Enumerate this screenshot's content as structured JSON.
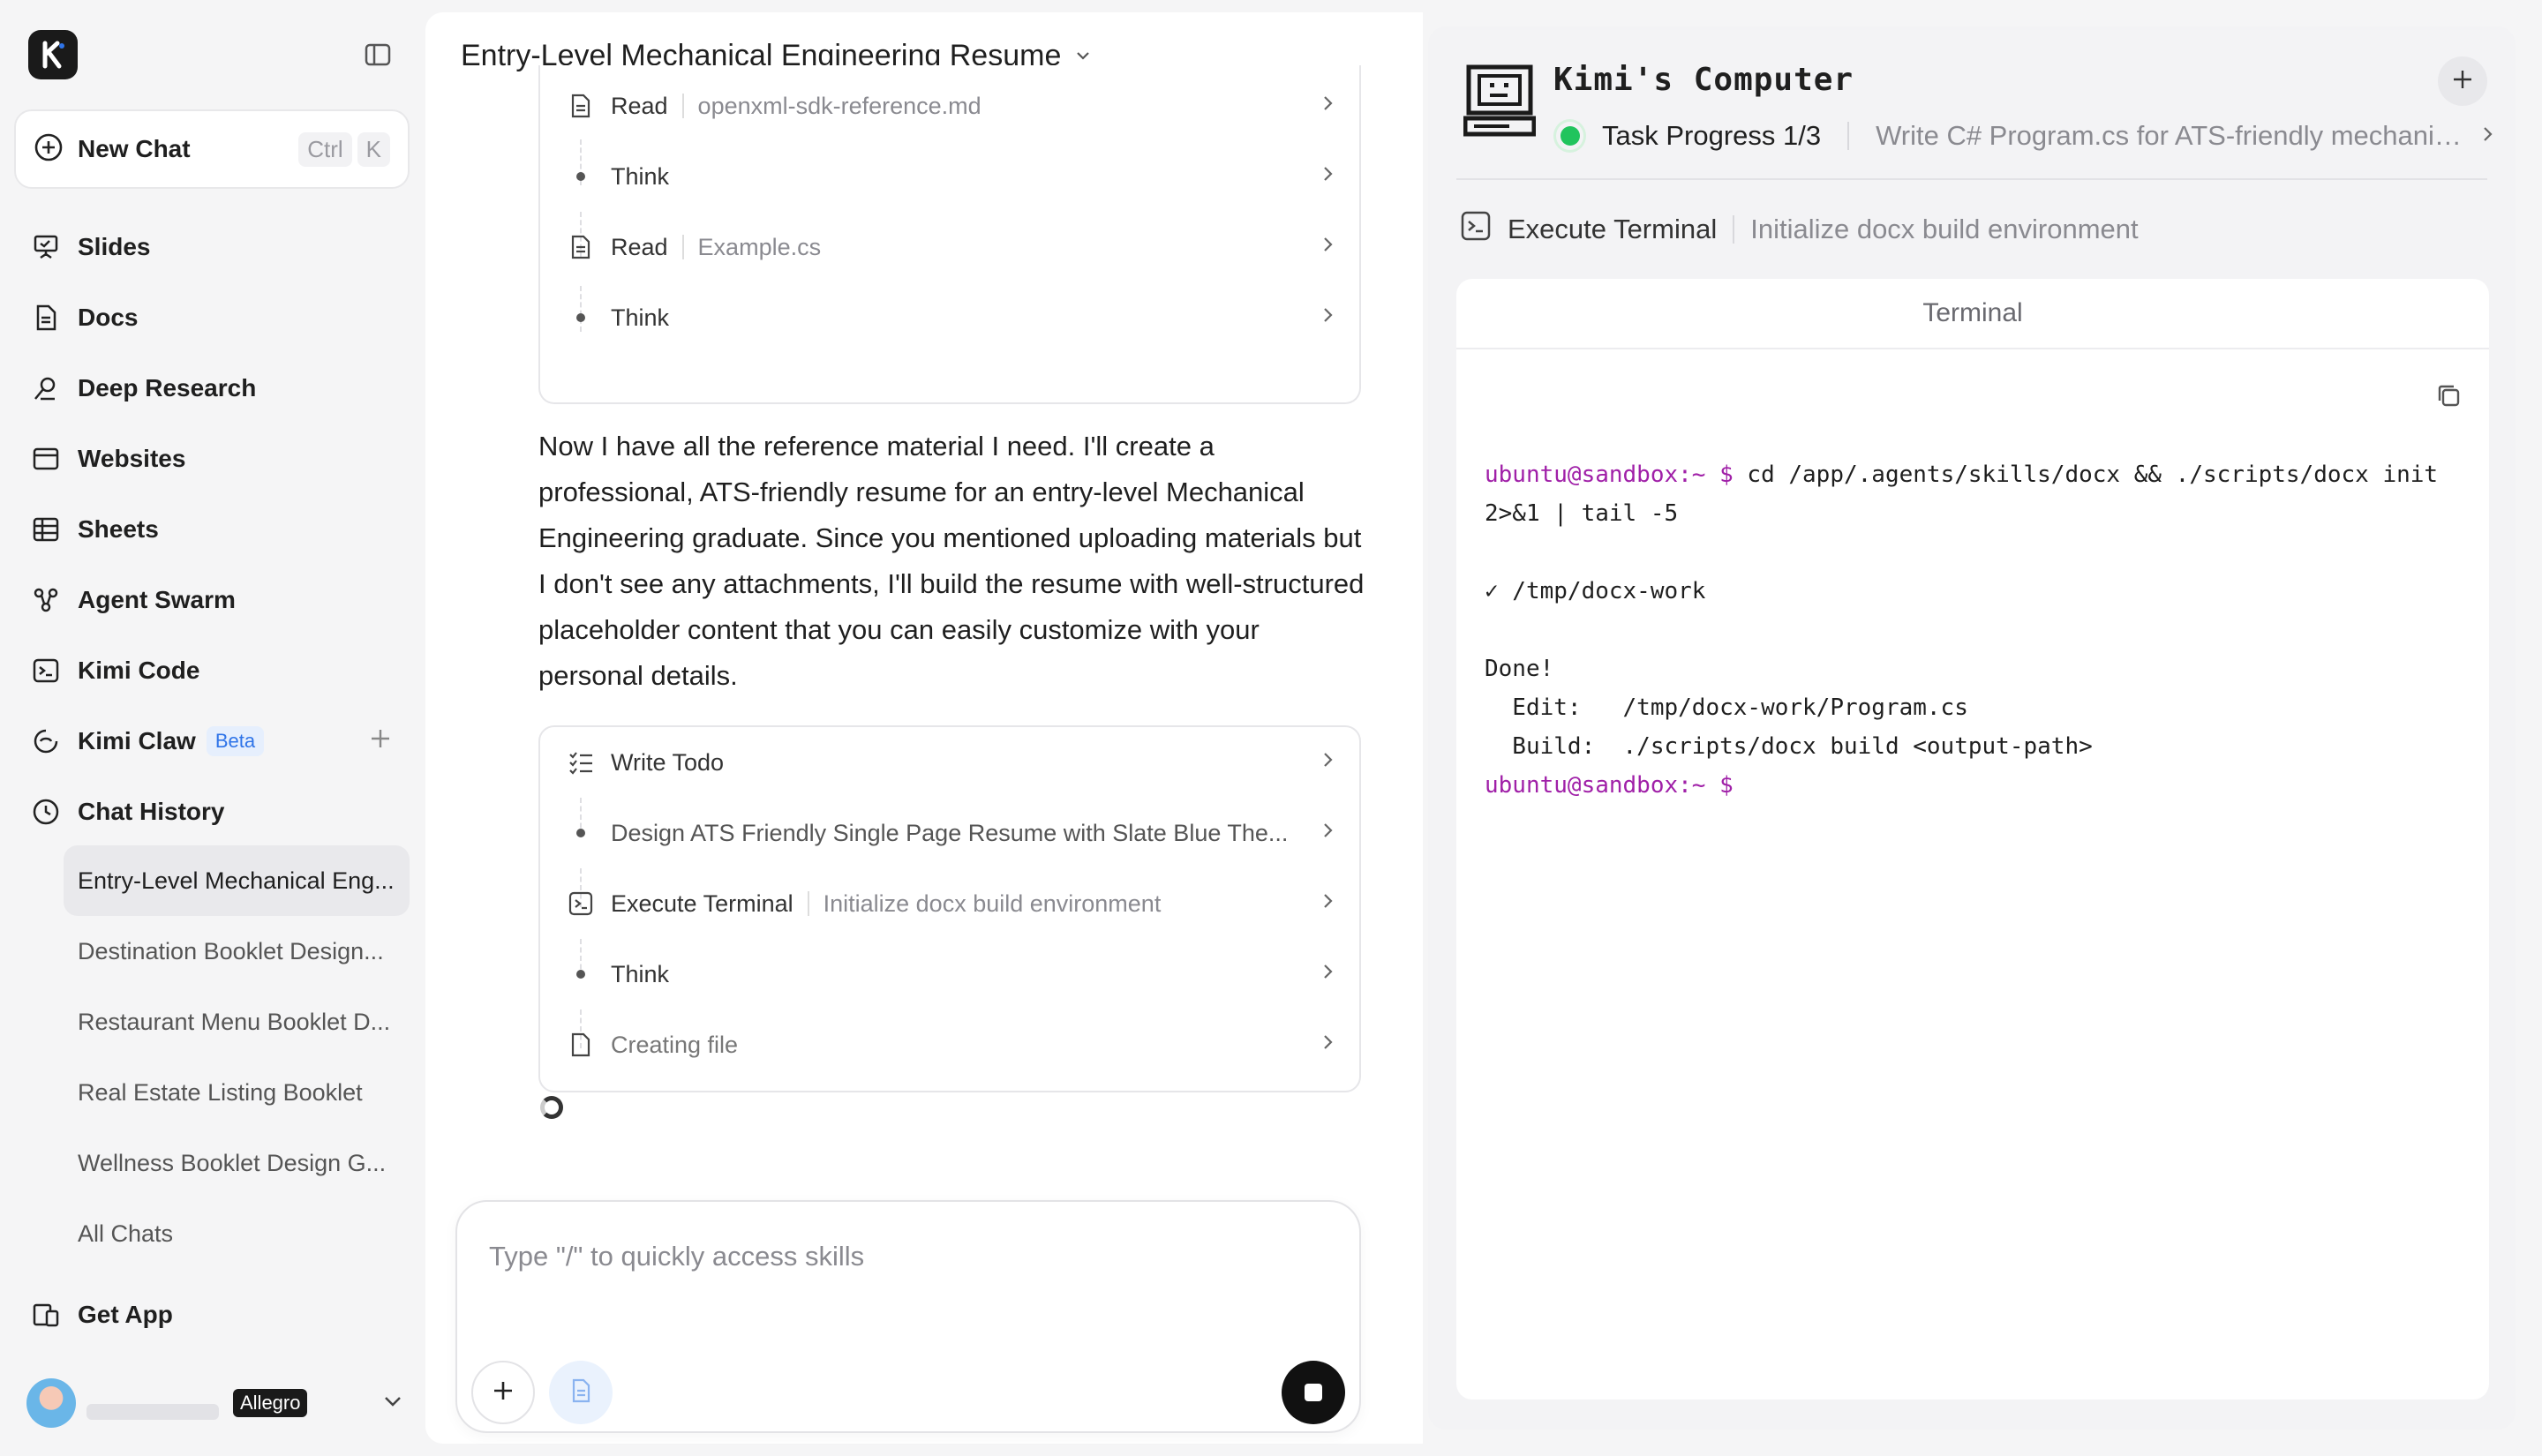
{
  "sidebar": {
    "new_chat": {
      "label": "New Chat",
      "shortcut": [
        "Ctrl",
        "K"
      ]
    },
    "nav": [
      {
        "label": "Slides",
        "icon": "slides-icon"
      },
      {
        "label": "Docs",
        "icon": "docs-icon"
      },
      {
        "label": "Deep Research",
        "icon": "deep-research-icon"
      },
      {
        "label": "Websites",
        "icon": "websites-icon"
      },
      {
        "label": "Sheets",
        "icon": "sheets-icon"
      },
      {
        "label": "Agent Swarm",
        "icon": "agent-swarm-icon"
      },
      {
        "label": "Kimi Code",
        "icon": "terminal-icon"
      },
      {
        "label": "Kimi Claw",
        "icon": "claw-icon",
        "badge": "Beta"
      },
      {
        "label": "Chat History",
        "icon": "clock-icon"
      }
    ],
    "history": [
      "Entry-Level Mechanical Eng...",
      "Destination Booklet Design...",
      "Restaurant Menu Booklet D...",
      "Real Estate Listing Booklet",
      "Wellness Booklet Design G...",
      "All Chats"
    ],
    "get_app": "Get App",
    "user": {
      "plan_badge": "Allegro"
    }
  },
  "chat": {
    "title": "Entry-Level Mechanical Engineering Resume",
    "steps_top": [
      {
        "type": "Read",
        "detail": "openxml-sdk-reference.md"
      },
      {
        "type": "Think",
        "detail": ""
      },
      {
        "type": "Read",
        "detail": "Example.cs"
      },
      {
        "type": "Think",
        "detail": ""
      }
    ],
    "message": "Now I have all the reference material I need. I'll create a professional, ATS-friendly resume for an entry-level Mechanical Engineering graduate. Since you mentioned uploading materials but I don't see any attachments, I'll build the resume with well-structured placeholder content that you can easily customize with your personal details.",
    "steps_bottom": [
      {
        "type": "Write Todo",
        "detail": ""
      },
      {
        "type": "Design ATS Friendly Single Page Resume with Slate Blue The...",
        "detail": ""
      },
      {
        "type": "Execute Terminal",
        "detail": "Initialize docx build environment"
      },
      {
        "type": "Think",
        "detail": ""
      },
      {
        "type": "Creating file",
        "detail": ""
      }
    ],
    "composer_placeholder": "Type \"/\" to quickly access skills"
  },
  "computer": {
    "title": "Kimi's Computer",
    "task_progress": "Task Progress 1/3",
    "task_desc": "Write C# Program.cs for ATS-friendly mechanic...",
    "exec_label": "Execute Terminal",
    "exec_detail": "Initialize docx build environment",
    "terminal_title": "Terminal",
    "terminal": {
      "prompt": "ubuntu@sandbox:~ $",
      "command": " cd /app/.agents/skills/docx && ./scripts/docx init\n2>&1 | tail -5",
      "output": "\n✓ /tmp/docx-work\n\nDone!\n  Edit:   /tmp/docx-work/Program.cs\n  Build:  ./scripts/docx build <output-path>",
      "prompt2": "ubuntu@sandbox:~ $"
    }
  },
  "colors": {
    "accent_blue": "#2f74e8",
    "prompt_purple": "#a020a8",
    "status_green": "#21c45d"
  }
}
